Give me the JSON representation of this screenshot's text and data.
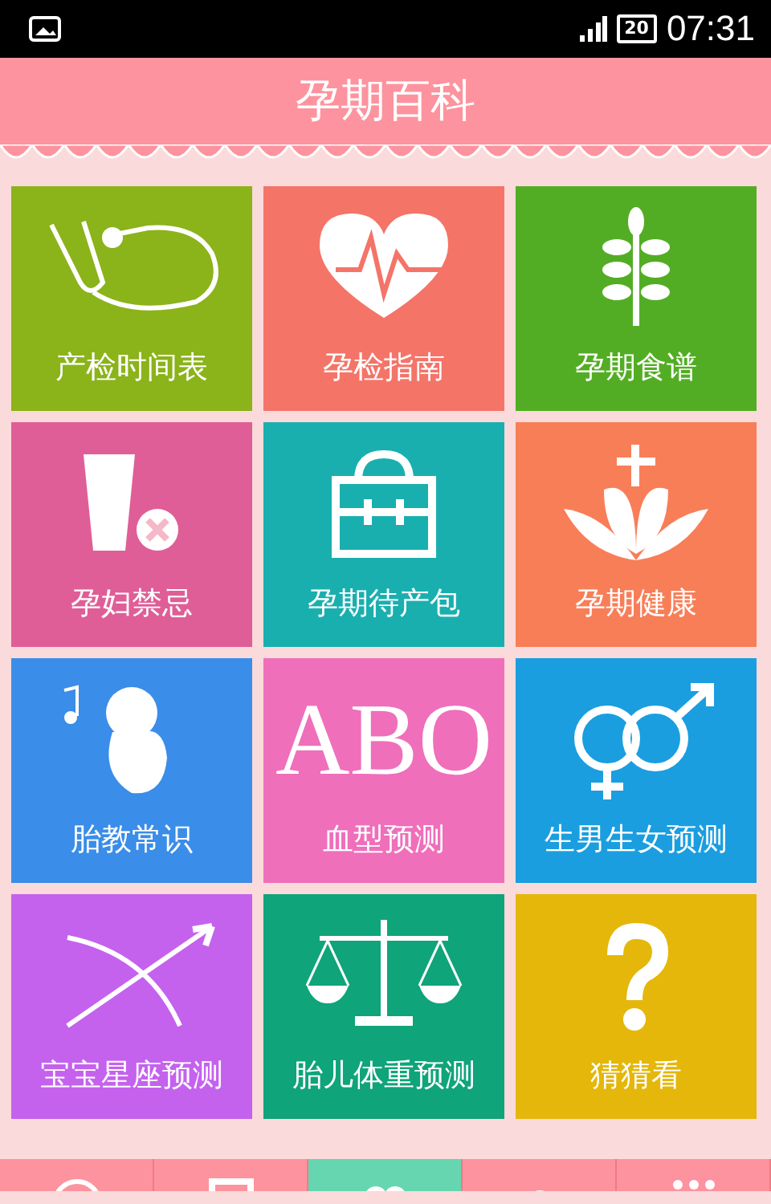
{
  "status_bar": {
    "battery": "20",
    "time": "07:31"
  },
  "header": {
    "title": "孕期百科"
  },
  "tile_rows": [
    {
      "tiles": [
        {
          "label": "产检时间表",
          "color": "#8bb31a"
        },
        {
          "label": "孕检指南",
          "color": "#f47468"
        },
        {
          "label": "孕期食谱",
          "color": "#53ad24"
        }
      ]
    },
    {
      "tiles": [
        {
          "label": "孕妇禁忌",
          "color": "#df5e97"
        },
        {
          "label": "孕期待产包",
          "color": "#1aafaf"
        },
        {
          "label": "孕期健康",
          "color": "#f87e58"
        }
      ]
    },
    {
      "tiles": [
        {
          "label": "胎教常识",
          "color": "#3a8de8"
        },
        {
          "art_text": "ABO",
          "label": "血型预测",
          "color": "#ef6fbb"
        },
        {
          "label": "生男生女预测",
          "color": "#1a9ee0"
        }
      ]
    },
    {
      "tiles": [
        {
          "label": "宝宝星座预测",
          "color": "#c462ee"
        },
        {
          "label": "胎儿体重预测",
          "color": "#0fa47a"
        },
        {
          "label": "猜猜看",
          "color": "#e4b70a"
        }
      ]
    }
  ],
  "bottom_nav": [
    {
      "selected": false
    },
    {
      "selected": false
    },
    {
      "selected": true
    },
    {
      "selected": false
    },
    {
      "selected": false
    }
  ]
}
